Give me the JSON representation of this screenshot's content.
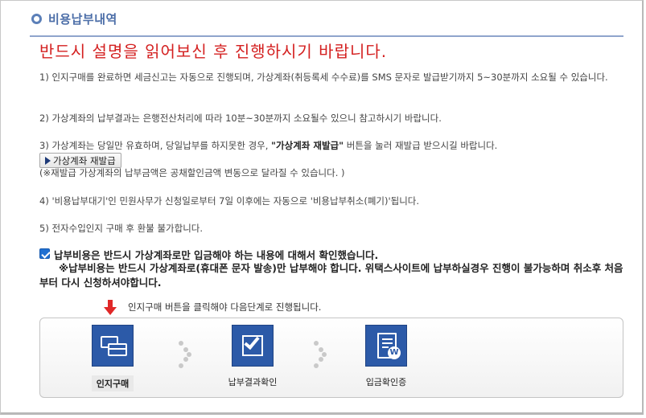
{
  "header": {
    "title": "비용납부내역"
  },
  "warning": "반드시 설명을 읽어보신 후 진행하시기 바랍니다.",
  "notes": {
    "n1": "1) 인지구매를 완료하면 세금신고는 자동으로 진행되며, 가상계좌(취등록세 수수료)를 SMS 문자로 발급받기까지 5~30분까지 소요될 수 있습니다.",
    "n2": "2) 가상계좌의 납부결과는 은행전산처리에 따라 10분~30분까지 소요될수 있으니 참고하시기 바랍니다.",
    "n3_pre": "3) 가상계좌는 당일만 유효하며, 당일납부를 하지못한 경우, ",
    "n3_bold": "\"가상계좌 재발급\"",
    "n3_post": " 버튼을 눌러 재발급 받으시길 바랍니다.",
    "n3_sub": "(※재발급 가상계좌의 납부금액은 공채할인금액 변동으로 달라질 수 있습니다. )",
    "n4": "4) '비용납부대기'인 민원사무가 신청일로부터 7일 이후에는 자동으로 '비용납부취소(폐기)'됩니다.",
    "n5": "5) 전자수입인지 구매 후 환불 불가합니다."
  },
  "reissue_button": "가상계좌 재발급",
  "confirm": {
    "checked": true,
    "main": "납부비용은 반드시 가상계좌로만 입금해야 하는 내용에 대해서 확인했습니다.",
    "sub": "※납부비용는 반드시 가상계좌로(휴대폰 문자 발송)만 납부해야 합니다. 위택스사이트에 납부하실경우 진행이 불가능하며 취소후 처음부터 다시 신청하셔야합니다."
  },
  "guide": "인지구매 버튼을 클릭해야 다음단계로 진행됩니다.",
  "steps": [
    {
      "label": "인지구매",
      "icon": "card-icon",
      "active": true
    },
    {
      "label": "납부결과확인",
      "icon": "checkbox-icon",
      "active": false
    },
    {
      "label": "입금확인증",
      "icon": "receipt-won-icon",
      "active": false
    }
  ],
  "colors": {
    "accent": "#2c5aa8",
    "warning": "#d42020",
    "header": "#4c6ea8"
  }
}
